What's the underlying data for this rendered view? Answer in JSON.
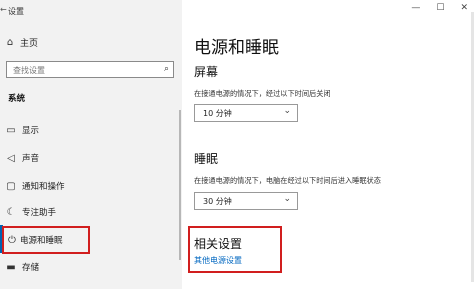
{
  "window": {
    "title": "设置",
    "minimize_glyph": "—",
    "maximize_glyph": "☐",
    "close_glyph": "✕"
  },
  "sidebar": {
    "home_label": "主页",
    "search_placeholder": "查找设置",
    "section_label": "系统",
    "items": [
      {
        "label": "显示",
        "icon": "monitor-icon"
      },
      {
        "label": "声音",
        "icon": "speaker-icon"
      },
      {
        "label": "通知和操作",
        "icon": "notification-icon"
      },
      {
        "label": "专注助手",
        "icon": "moon-icon"
      },
      {
        "label": "电源和睡眠",
        "icon": "power-icon",
        "selected": true
      },
      {
        "label": "存储",
        "icon": "storage-icon"
      }
    ]
  },
  "main": {
    "title": "电源和睡眠",
    "screen": {
      "heading": "屏幕",
      "description": "在接通电源的情况下，经过以下时间后关闭",
      "value": "10 分钟"
    },
    "sleep": {
      "heading": "睡眠",
      "description": "在接通电源的情况下，电脑在经过以下时间后进入睡眠状态",
      "value": "30 分钟"
    },
    "related": {
      "heading": "相关设置",
      "link": "其他电源设置"
    }
  },
  "colors": {
    "accent": "#0063b1",
    "link": "#0067c0",
    "highlight_box": "#d11e1e",
    "sidebar_bg": "#f2f2f2"
  }
}
